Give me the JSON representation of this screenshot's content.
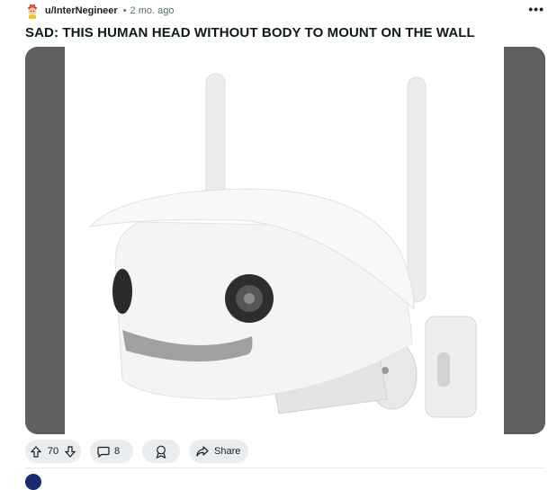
{
  "post": {
    "username": "u/InterNegineer",
    "separator": "•",
    "age": "2 mo. ago",
    "more_label": "•••",
    "title": "SAD: THIS HUMAN HEAD WITHOUT BODY TO MOUNT ON THE WALL",
    "media": {
      "description_icon": "image-icon",
      "side_bar_color": "#5f5f5f",
      "background_color": "#ffffff"
    }
  },
  "actions": {
    "upvote_icon": "arrow-up-icon",
    "score": "70",
    "downvote_icon": "arrow-down-icon",
    "comments_icon": "comment-icon",
    "comments_count": "8",
    "award_icon": "award-icon",
    "share_icon": "share-arrow-icon",
    "share_label": "Share"
  },
  "colors": {
    "pill_background": "#eaedef",
    "text": "#1c1c1c",
    "muted": "#576f76"
  }
}
